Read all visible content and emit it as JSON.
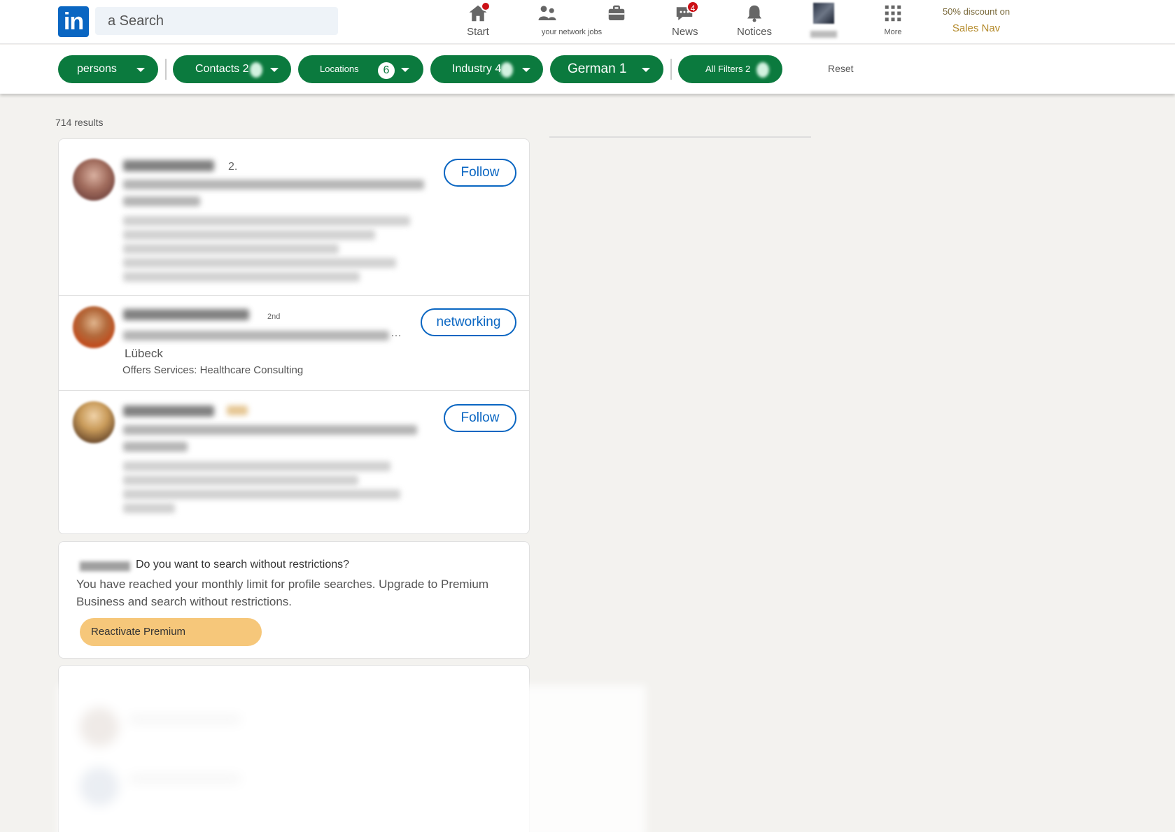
{
  "nav": {
    "search_placeholder": "a Search",
    "items": [
      {
        "label": "Start",
        "badge": ""
      },
      {
        "label": "your network jobs",
        "badge": ""
      },
      {
        "label": "News",
        "badge": "4"
      },
      {
        "label": "Notices",
        "badge": ""
      },
      {
        "label": "More"
      }
    ],
    "promo": {
      "top": "50% discount on",
      "link": "Sales Nav"
    },
    "brand_color": "#0a66c2"
  },
  "filters": {
    "pills": [
      {
        "label": "persons"
      },
      {
        "label": "Contacts 2"
      },
      {
        "label": "Locations",
        "count": "6"
      },
      {
        "label": "Industry 4"
      },
      {
        "label": "German 1"
      },
      {
        "label": "All Filters 2"
      }
    ],
    "reset": "Reset",
    "pill_color": "#0b7a3e"
  },
  "results": {
    "count_text": "714 results",
    "items": [
      {
        "degree": "2.",
        "action": "Follow"
      },
      {
        "degree": "2nd",
        "location": "Lübeck",
        "services": "Offers Services: Healthcare Consulting",
        "action": "networking"
      },
      {
        "degree": "",
        "action": "Follow"
      }
    ]
  },
  "premium": {
    "question": "Do you want to search without restrictions?",
    "message": "You have reached your monthly limit for profile searches. Upgrade to Premium Business and search without restrictions.",
    "button": "Reactivate Premium",
    "button_color": "#f6c77a"
  }
}
